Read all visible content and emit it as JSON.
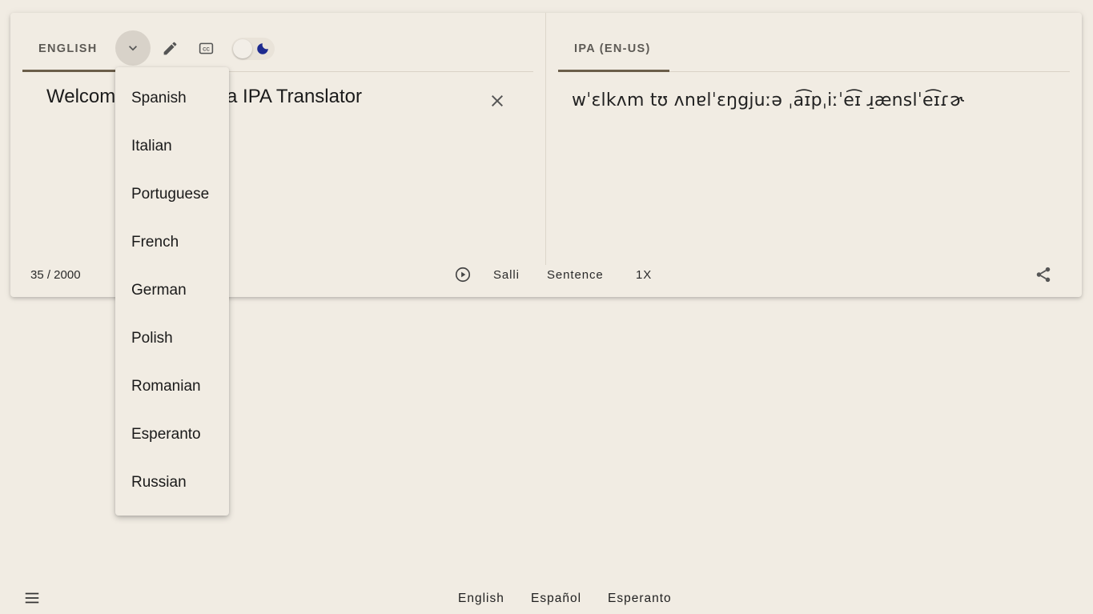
{
  "source": {
    "tab_label": "ENGLISH",
    "text": "Welcome to Anglingua IPA Translator",
    "char_count": "35 / 2000"
  },
  "target": {
    "tab_label": "IPA (EN-US)",
    "ipa_text": "wˈɛlkʌm  tʊ  ʌnɐlˈɛŋgjuːə  ˌa͡ɪpˌiːˈe͡ɪ  ɹ̠ænslˈe͡ɪɾɚ"
  },
  "toolbar": {
    "voice": "Salli",
    "mode": "Sentence",
    "speed": "1X"
  },
  "language_menu": {
    "items": [
      "Spanish",
      "Italian",
      "Portuguese",
      "French",
      "German",
      "Polish",
      "Romanian",
      "Esperanto",
      "Russian"
    ]
  },
  "bottom_nav": {
    "languages": [
      "English",
      "Español",
      "Esperanto"
    ]
  },
  "colors": {
    "background": "#f1ece3",
    "tab_indicator": "#6b5e4a",
    "toggle_moon": "#1d2a8f"
  },
  "icons": {
    "dropdown": "chevron-down-icon",
    "edit": "pencil-icon",
    "captions": "closed-captions-icon",
    "theme": "moon-icon",
    "clear": "close-icon",
    "play": "play-circle-icon",
    "share": "share-icon",
    "menu": "hamburger-menu-icon"
  }
}
